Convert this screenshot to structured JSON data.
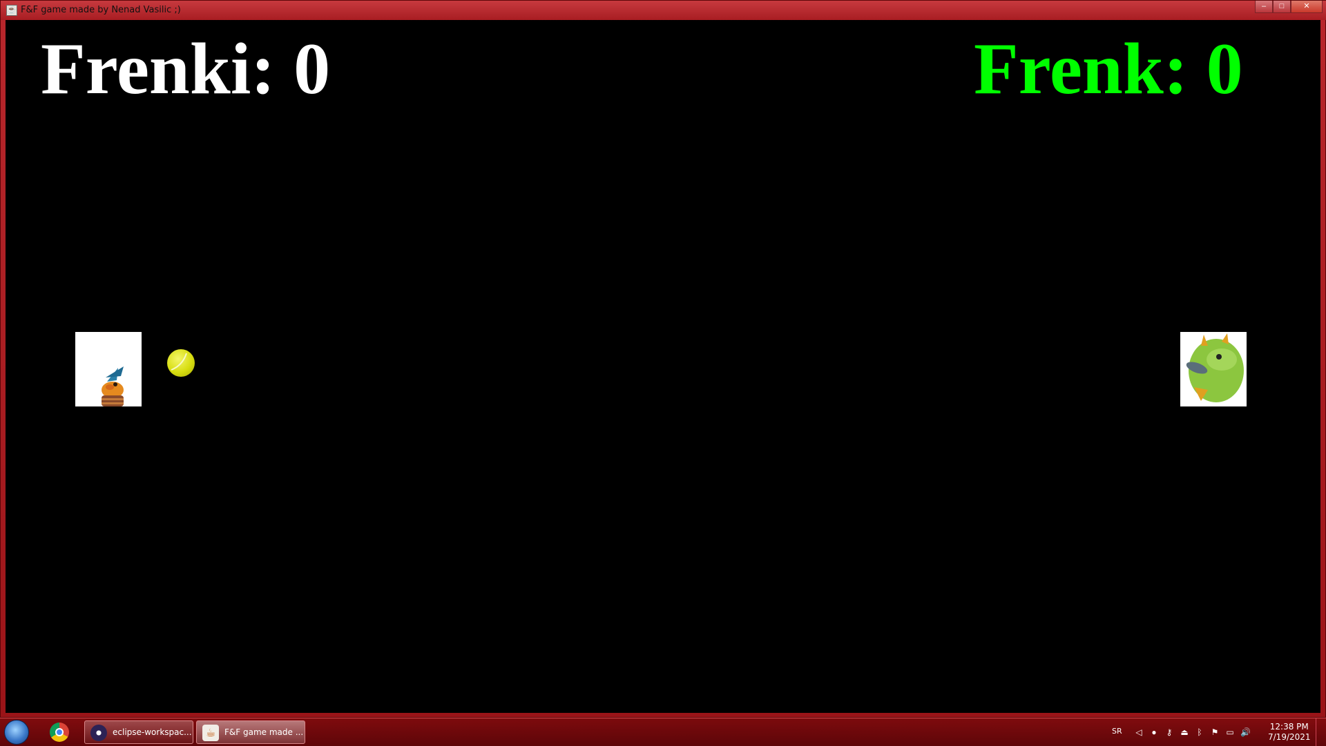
{
  "window": {
    "title": "F&F game made by Nenad Vasilic ;)",
    "controls": {
      "minimize": "–",
      "maximize": "□",
      "close": "✕"
    }
  },
  "game": {
    "player_left": {
      "label": "Frenki: 0",
      "color": "#ffffff",
      "avatar": "orange-bird-character"
    },
    "player_right": {
      "label": "Frenk: 0",
      "color": "#00ff00",
      "avatar": "green-furry-monster"
    },
    "ball": {
      "icon": "tennis-ball",
      "color": "#d7dd10"
    },
    "background": "#000000"
  },
  "taskbar": {
    "items": [
      {
        "label": "eclipse-workspac..."
      },
      {
        "label": "F&F game made ..."
      }
    ],
    "language": "SR",
    "clock": {
      "time": "12:38 PM",
      "date": "7/19/2021"
    }
  }
}
